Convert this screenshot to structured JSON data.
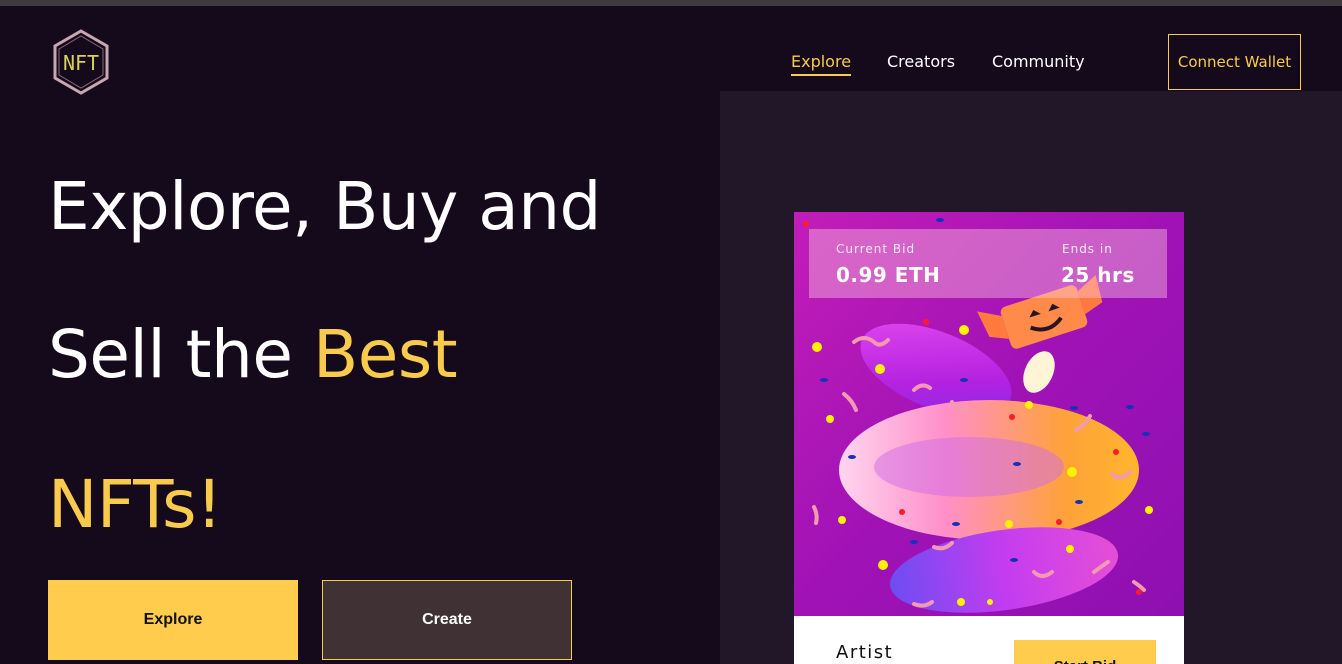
{
  "brand": {
    "logo_text": "NFT"
  },
  "nav": {
    "items": [
      {
        "label": "Explore",
        "active": true
      },
      {
        "label": "Creators",
        "active": false
      },
      {
        "label": "Community",
        "active": false
      }
    ],
    "connect_wallet": "Connect Wallet"
  },
  "hero": {
    "line1": "Explore, Buy and",
    "line2_plain": "Sell the ",
    "line2_accent": "Best",
    "line3_accent": "NFTs!",
    "explore_button": "Explore",
    "create_button": "Create"
  },
  "card": {
    "current_bid_label": "Current Bid",
    "current_bid_value": "0.99 ETH",
    "ends_in_label": "Ends in",
    "ends_in_value": "25 hrs",
    "artist_label": "Artist",
    "start_bid_button": "Start Bid"
  },
  "colors": {
    "background": "#150a1c",
    "panel": "#221729",
    "accent": "#f8cb4c",
    "button_yellow": "#ffcc4d"
  }
}
